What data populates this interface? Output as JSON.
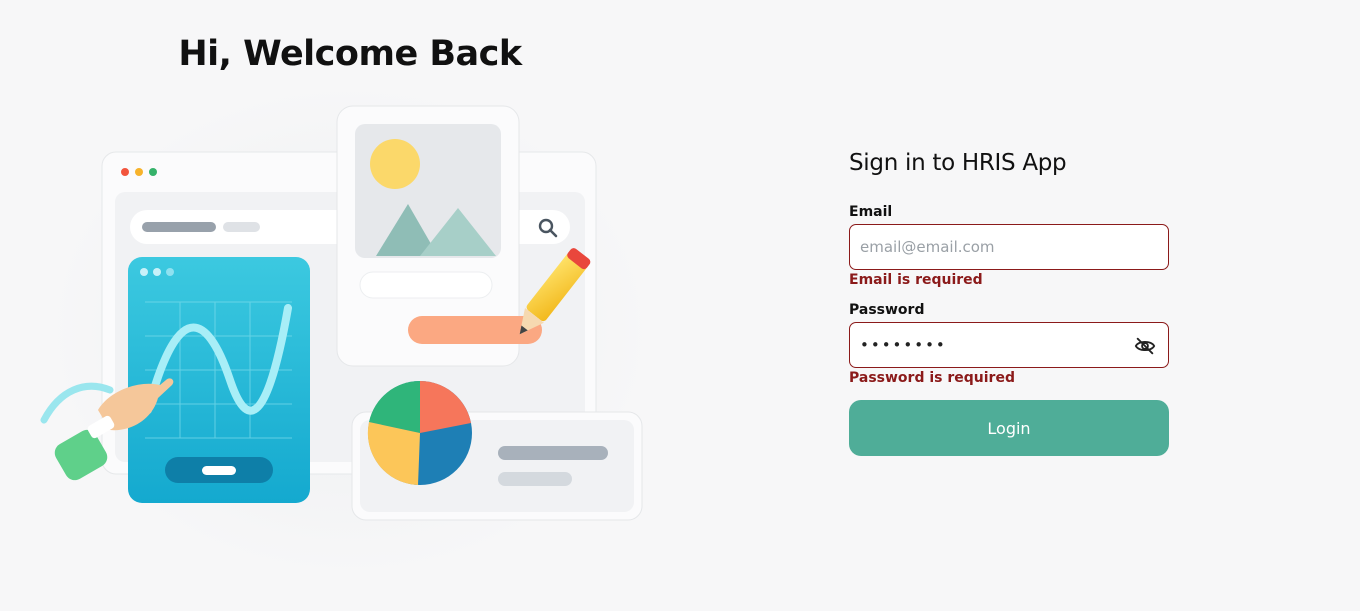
{
  "hero": {
    "title": "Hi, Welcome Back"
  },
  "form": {
    "heading": "Sign in to HRIS App",
    "email": {
      "label": "Email",
      "placeholder": "email@email.com",
      "value": "",
      "error": "Email is required"
    },
    "password": {
      "label": "Password",
      "masked_value": "••••••••",
      "error": "Password is required",
      "toggle_icon": "eye-off-icon"
    },
    "login_label": "Login"
  },
  "colors": {
    "background": "#f7f7f8",
    "accent": "#4fad98",
    "error": "#8b1a1a"
  }
}
